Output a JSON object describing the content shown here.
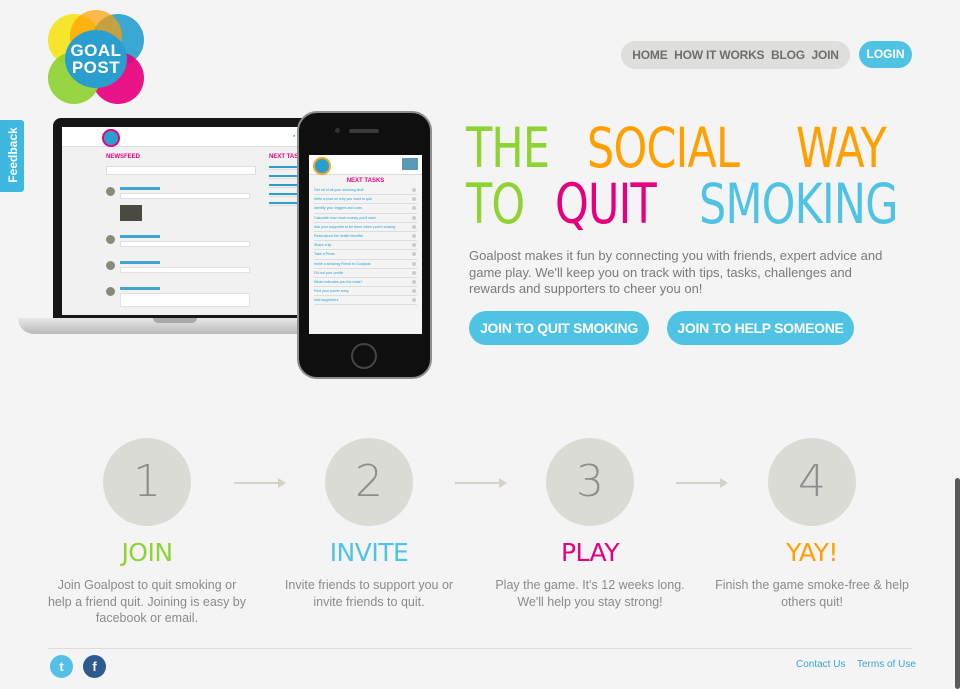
{
  "logo": {
    "line1": "GOAL",
    "line2": "POST",
    "colors": [
      "#f5e31a",
      "#8ed332",
      "#e6007e",
      "#2a9fcf",
      "#ffa000"
    ]
  },
  "nav": {
    "items": [
      "HOME",
      "HOW IT WORKS",
      "BLOG",
      "JOIN"
    ],
    "login": "LOGIN"
  },
  "feedback": {
    "label": "Feedback"
  },
  "laptop": {
    "newsfeed_title": "NEWSFEED",
    "next_tasks_title": "NEXT TASKS"
  },
  "phone": {
    "next_tasks_title": "NEXT TASKS",
    "tasks": [
      "Get rid of all your smoking stuff",
      "Write a post on why you want to quit",
      "Identify your triggers and cues",
      "Calculate how much money you'll save",
      "Ask your supporter to be there when you're craving",
      "Read about the health benefits",
      "Share a tip",
      "Take a Photo",
      "Invite a smoking Friend to Goalpost",
      "Fill out your profile",
      "What motivates you the most?",
      "Find your power song",
      "Add supporters"
    ]
  },
  "hero": {
    "headline_line1": [
      {
        "text": "THE",
        "color": "#8ed332"
      },
      {
        "text": "SOCIAL",
        "color": "#ffa000"
      },
      {
        "text": "WAY",
        "color": "#ffa000"
      }
    ],
    "headline_line2": [
      {
        "text": "TO",
        "color": "#8ed332"
      },
      {
        "text": "QUIT",
        "color": "#e6007e"
      },
      {
        "text": "SMOKING",
        "color": "#4fc3e3"
      }
    ],
    "intro": "Goalpost makes it fun by connecting you with friends, expert advice and game play. We'll keep you on track with tips, tasks, challenges and rewards and supporters to cheer you on!",
    "cta_quit": "JOIN TO QUIT SMOKING",
    "cta_help": "JOIN TO HELP SOMEONE"
  },
  "steps": [
    {
      "number": "1",
      "label": "JOIN",
      "color": "#8ed332",
      "desc": "Join Goalpost to quit smoking or help a friend quit. Joining is easy by facebook or email."
    },
    {
      "number": "2",
      "label": "INVITE",
      "color": "#4fc3e3",
      "desc": "Invite friends to support you or invite friends to quit."
    },
    {
      "number": "3",
      "label": "PLAY",
      "color": "#e6007e",
      "desc": "Play the game. It's 12 weeks long. We'll help you stay strong!"
    },
    {
      "number": "4",
      "label": "YAY!",
      "color": "#ffa000",
      "desc": "Finish the game smoke-free & help others quit!"
    }
  ],
  "footer": {
    "twitter_icon": "twitter-icon",
    "facebook_icon": "facebook-icon",
    "contact": "Contact Us",
    "terms": "Terms of Use"
  }
}
